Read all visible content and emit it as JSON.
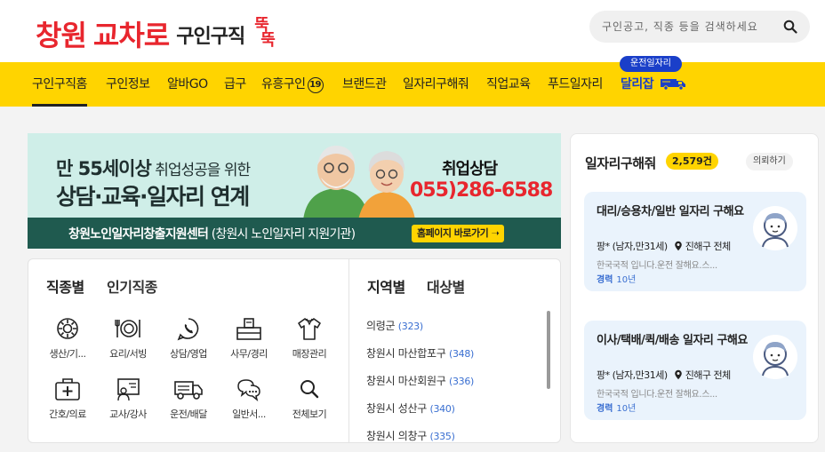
{
  "logo": {
    "city": "창원",
    "brand": "교차로",
    "sub": "구인구직",
    "tt1": "뚝",
    "tt2": "뚝"
  },
  "search": {
    "placeholder": "구인공고, 직종 등을 검색하세요"
  },
  "nav": {
    "items": [
      {
        "label": "구인구직홈",
        "active": true
      },
      {
        "label": "구인정보"
      },
      {
        "label": "알바GO"
      },
      {
        "label": "급구"
      },
      {
        "label": "유흥구인",
        "badge": "19"
      },
      {
        "label": "브랜드관"
      },
      {
        "label": "일자리구해줘"
      },
      {
        "label": "직업교육"
      },
      {
        "label": "푸드일자리"
      },
      {
        "label": "달리잡",
        "tag": "운전일자리"
      }
    ]
  },
  "banner": {
    "line1_bold": "만 55세이상",
    "line1_thin": " 취업성공을 위한",
    "line2": "상담·교육·일자리 연계",
    "consult": "취업상담",
    "phone_area": "055)",
    "phone_num": "286-6588",
    "org": "창원노인일자리창출지원센터",
    "org_sub": " (창원시 노인일자리 지원기관)",
    "button": "홈페이지 바로가기"
  },
  "categories": {
    "tabs": [
      "직종별",
      "인기직종"
    ],
    "items": [
      {
        "label": "생산/기...",
        "icon": "gear-icon"
      },
      {
        "label": "요리/서빙",
        "icon": "dining-icon"
      },
      {
        "label": "상담/영업",
        "icon": "phone-chat-icon"
      },
      {
        "label": "사무/경리",
        "icon": "office-desk-icon"
      },
      {
        "label": "매장관리",
        "icon": "shirt-icon"
      },
      {
        "label": "간호/의료",
        "icon": "medical-kit-icon"
      },
      {
        "label": "교사/강사",
        "icon": "teacher-board-icon"
      },
      {
        "label": "운전/배달",
        "icon": "truck-icon"
      },
      {
        "label": "일반서...",
        "icon": "speech-bubble-icon"
      },
      {
        "label": "전체보기",
        "icon": "search-icon"
      }
    ]
  },
  "regions": {
    "tabs": [
      "지역별",
      "대상별"
    ],
    "items": [
      {
        "name": "의령군",
        "count": "(323)"
      },
      {
        "name": "창원시 마산합포구",
        "count": "(348)"
      },
      {
        "name": "창원시 마산회원구",
        "count": "(336)"
      },
      {
        "name": "창원시 성산구",
        "count": "(340)"
      },
      {
        "name": "창원시 의창구",
        "count": "(335)"
      }
    ]
  },
  "right_panel": {
    "title": "일자리구해줘",
    "count": "2,579건",
    "request": "의뢰하기",
    "cards": [
      {
        "title": "대리/승용차/일반 일자리 구해요",
        "person": "팡* (남자,만31세)",
        "location": "진해구 전체",
        "desc": "한국국적 입니다.운전 잘해요.스...",
        "exp_label": "경력",
        "exp": "10년"
      },
      {
        "title": "이사/택배/퀵/배송 일자리 구해요",
        "person": "팡* (남자,만31세)",
        "location": "진해구 전체",
        "desc": "한국국적 입니다.운전 잘해요.스...",
        "exp_label": "경력",
        "exp": "10년"
      }
    ]
  },
  "colors": {
    "brand_red": "#e8262e",
    "nav_yellow": "#ffd400",
    "accent_blue": "#1a3fc9",
    "banner_green": "#1f5a4f"
  }
}
